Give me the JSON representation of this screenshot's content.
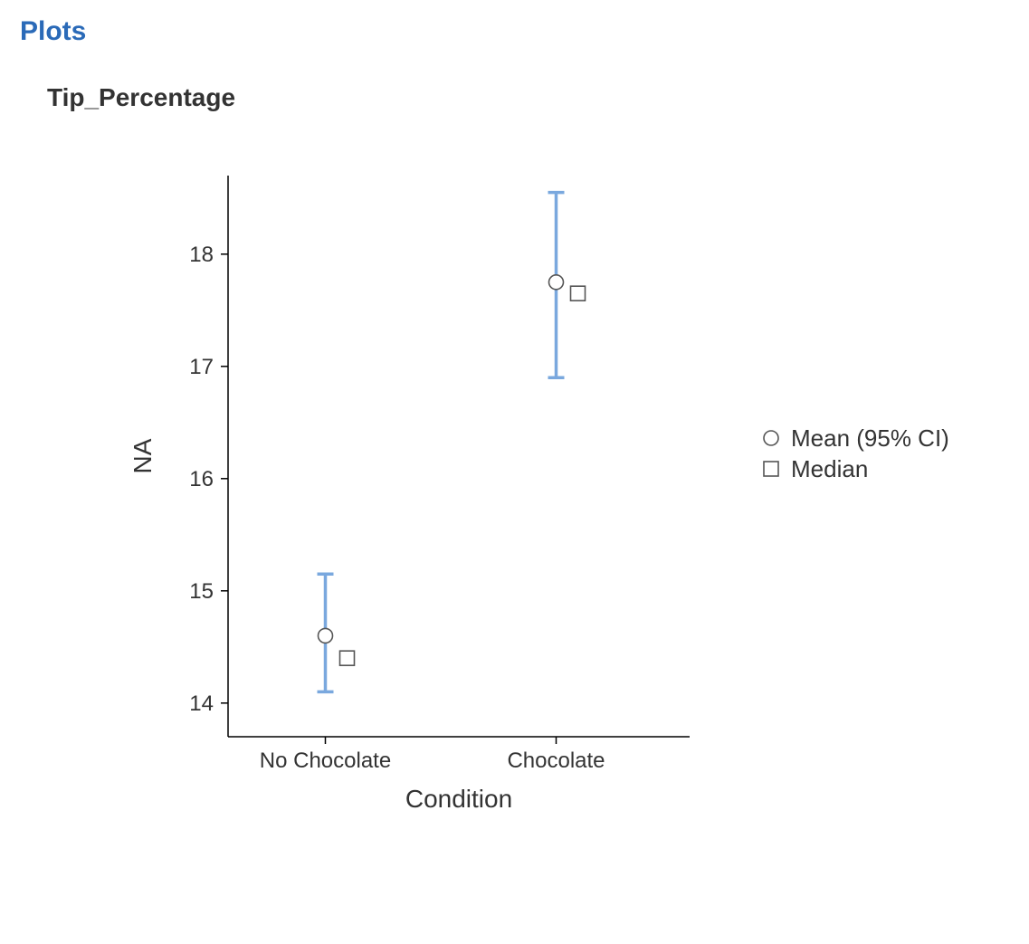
{
  "section_title": "Plots",
  "chart_title": "Tip_Percentage",
  "ylabel": "NA",
  "xlabel": "Condition",
  "legend": {
    "mean": "Mean (95% CI)",
    "median": "Median"
  },
  "chart_data": {
    "type": "scatter",
    "title": "Tip_Percentage",
    "xlabel": "Condition",
    "ylabel": "NA",
    "categories": [
      "No Chocolate",
      "Chocolate"
    ],
    "series": [
      {
        "name": "Mean (95% CI)",
        "values": [
          14.6,
          17.75
        ],
        "ci_low": [
          14.1,
          16.9
        ],
        "ci_high": [
          15.15,
          18.55
        ]
      },
      {
        "name": "Median",
        "values": [
          14.4,
          17.65
        ]
      }
    ],
    "ylim": [
      13.7,
      18.7
    ],
    "y_ticks": [
      14,
      15,
      16,
      17,
      18
    ]
  }
}
